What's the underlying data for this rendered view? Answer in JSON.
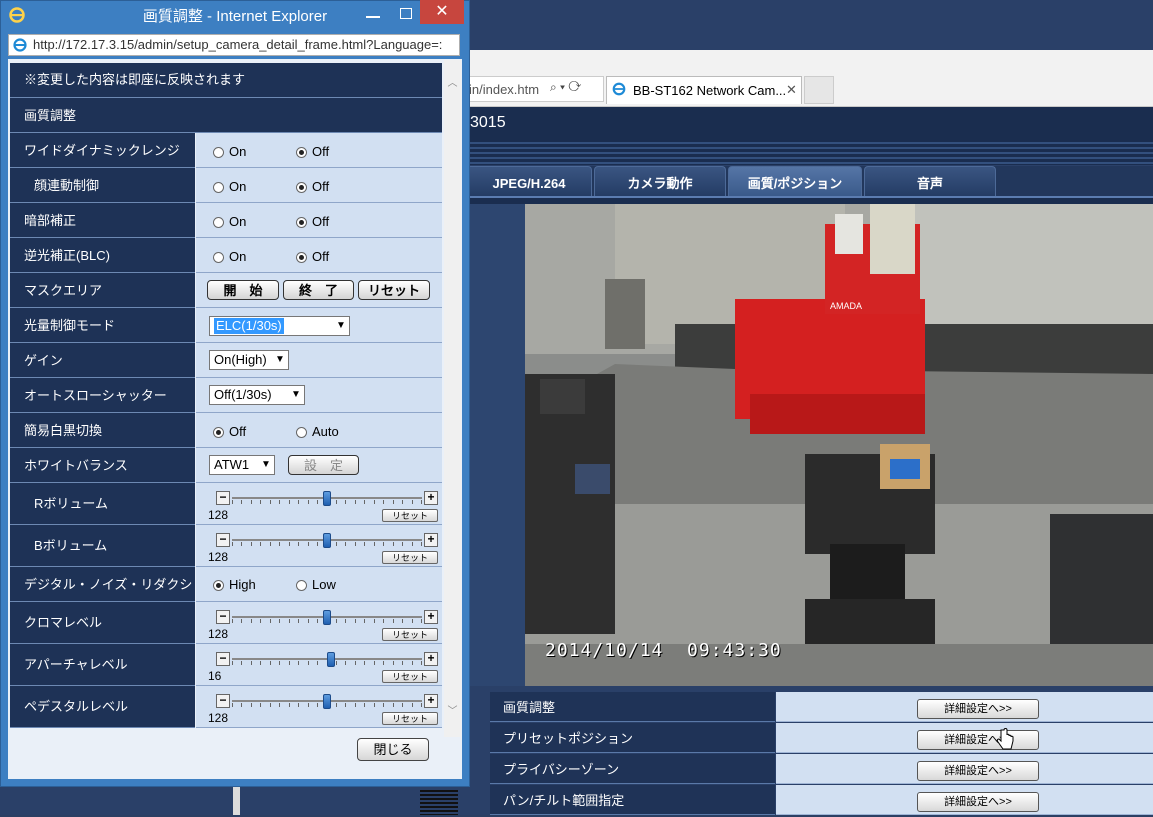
{
  "popup": {
    "title": "画質調整 - Internet Explorer",
    "url": "http://172.17.3.15/admin/setup_camera_detail_frame.html?Language=:",
    "notice": "※変更した内容は即座に反映されます",
    "section_title": "画質調整",
    "on": "On",
    "off": "Off",
    "wdr": {
      "label": "ワイドダイナミックレンジ",
      "value": "Off"
    },
    "face": {
      "label": "顔連動制御",
      "value": "Off"
    },
    "dark": {
      "label": "暗部補正",
      "value": "Off"
    },
    "blc": {
      "label": "逆光補正(BLC)",
      "value": "Off"
    },
    "mask": {
      "label": "マスクエリア",
      "start": "開　始",
      "end": "終　了",
      "reset": "リセット"
    },
    "light_mode": {
      "label": "光量制御モード",
      "value": "ELC(1/30s)"
    },
    "gain": {
      "label": "ゲイン",
      "value": "On(High)"
    },
    "auto_slow": {
      "label": "オートスローシャッター",
      "value": "Off(1/30s)"
    },
    "bw": {
      "label": "簡易白黒切換",
      "opt_off": "Off",
      "opt_auto": "Auto",
      "value": "Off"
    },
    "wb": {
      "label": "ホワイトバランス",
      "value": "ATW1",
      "set": "設　定"
    },
    "r_vol": {
      "label": "Rボリューム",
      "value": "128",
      "level": 0.5,
      "reset": "リセット"
    },
    "b_vol": {
      "label": "Bボリューム",
      "value": "128",
      "level": 0.5,
      "reset": "リセット"
    },
    "dnr": {
      "label": "デジタル・ノイズ・リダクション",
      "opt_high": "High",
      "opt_low": "Low",
      "value": "High"
    },
    "chroma": {
      "label": "クロマレベル",
      "value": "128",
      "level": 0.5,
      "reset": "リセット"
    },
    "aperture": {
      "label": "アパーチャレベル",
      "value": "16",
      "level": 0.52,
      "reset": "リセット"
    },
    "pedestal": {
      "label": "ペデスタルレベル",
      "value": "128",
      "level": 0.5,
      "reset": "リセット"
    },
    "close": "閉じる"
  },
  "browser": {
    "address_partial": "in/index.htm",
    "tab_title": "BB-ST162 Network Cam...",
    "header_partial": "3015"
  },
  "camera_tabs": [
    "JPEG/H.264",
    "カメラ動作",
    "画質/ポジション",
    "音声"
  ],
  "active_tab": "画質/ポジション",
  "timestamp": "2014/10/14  09:43:30",
  "settings_rows": [
    {
      "label": "画質調整",
      "button": "詳細設定へ>>"
    },
    {
      "label": "プリセットポジション",
      "button": "詳細設定へ>>"
    },
    {
      "label": "プライバシーゾーン",
      "button": "詳細設定へ>>"
    },
    {
      "label": "パン/チルト範囲指定",
      "button": "詳細設定へ>>"
    }
  ],
  "colors": {
    "header_bg": "#1e3256",
    "value_bg": "#d2e0f2",
    "title_bar": "#3d7fc2",
    "close_red": "#c7463e"
  }
}
